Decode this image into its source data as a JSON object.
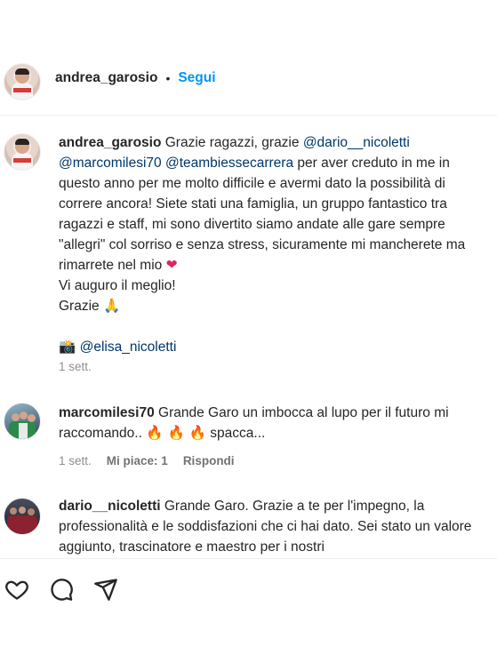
{
  "post_header": {
    "username": "andrea_garosio",
    "separator": "•",
    "follow_label": "Segui"
  },
  "caption": {
    "username": "andrea_garosio",
    "text_1": " Grazie ragazzi, grazie ",
    "mention_1": "@dario__nicoletti",
    "mention_2": "@marcomilesi70",
    "mention_3": "@teambiessecarrera",
    "text_2": " per aver creduto in me in questo anno per me molto difficile e avermi dato la possibilità di correre ancora! Siete stati una famiglia, un gruppo fantastico tra ragazzi e staff, mi sono divertito siamo andate alle gare sempre \"allegri\" col sorriso e senza stress, sicuramente mi mancherete ma rimarrete nel mio ",
    "heart": "❤",
    "line_auguro": "Vi auguro il meglio!",
    "line_grazie": "Grazie ",
    "pray": "🙏",
    "camera": "📸",
    "photo_credit": "@elisa_nicoletti",
    "time": "1 sett."
  },
  "comments": [
    {
      "username": "marcomilesi70",
      "text_1": " Grande Garo un imbocca al lupo per il futuro mi raccomando.. ",
      "fire": "🔥 🔥 🔥",
      "text_2": "spacca...",
      "time": "1 sett.",
      "likes": "Mi piace: 1",
      "reply": "Rispondi"
    },
    {
      "username": "dario__nicoletti",
      "text": " Grande Garo. Grazie a te per l'impegno, la professionalità e le soddisfazioni che ci hai dato. Sei stato un valore aggiunto, trascinatore e maestro per i nostri"
    }
  ],
  "icons": {
    "like": "heart-icon",
    "comment": "comment-icon",
    "share": "share-icon"
  }
}
